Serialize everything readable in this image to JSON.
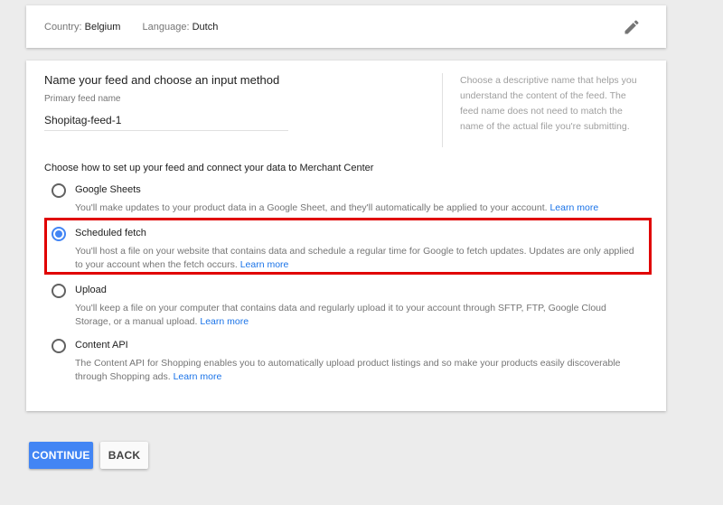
{
  "summary": {
    "country_label": "Country:",
    "country_value": "Belgium",
    "language_label": "Language:",
    "language_value": "Dutch",
    "edit_icon": "pencil-icon"
  },
  "feed": {
    "section_title": "Name your feed and choose an input method",
    "name_label": "Primary feed name",
    "name_value": "Shopitag-feed-1",
    "help_text": "Choose a descriptive name that helps you understand the content of the feed. The feed name does not need to match the name of the actual file you're submitting."
  },
  "input_method": {
    "label": "Choose how to set up your feed and connect your data to Merchant Center",
    "selected": "Scheduled fetch",
    "options": [
      {
        "title": "Google Sheets",
        "description": "You'll make updates to your product data in a Google Sheet, and they'll automatically be applied to your account.",
        "link": "Learn more",
        "checked": false
      },
      {
        "title": "Scheduled fetch",
        "description": "You'll host a file on your website that contains data and schedule a regular time for Google to fetch updates. Updates are only applied to your account when the fetch occurs.",
        "link": "Learn more",
        "checked": true
      },
      {
        "title": "Upload",
        "description": "You'll keep a file on your computer that contains data and regularly upload it to your account through SFTP, FTP, Google Cloud Storage, or a manual upload.",
        "link": "Learn more",
        "checked": false
      },
      {
        "title": "Content API",
        "description": "The Content API for Shopping enables you to automatically upload product listings and so make your products easily discoverable through Shopping ads.",
        "link": "Learn more",
        "checked": false
      }
    ]
  },
  "actions": {
    "continue_label": "CONTINUE",
    "back_label": "BACK"
  },
  "colors": {
    "accent": "#4285f4",
    "link": "#1a73e8",
    "highlight": "#e00000",
    "background": "#ececec"
  }
}
